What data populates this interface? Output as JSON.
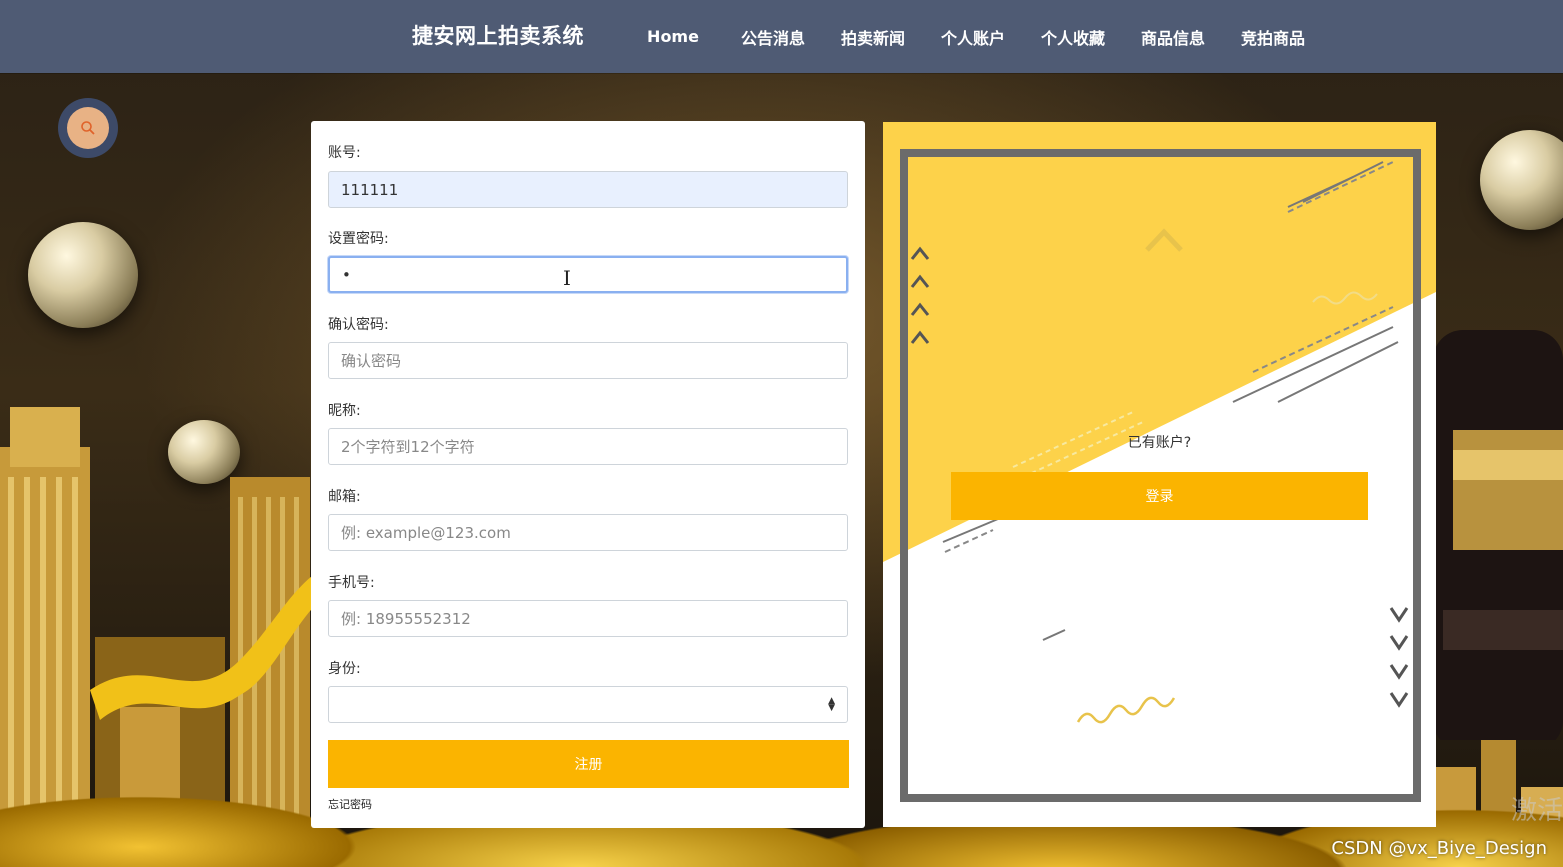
{
  "header": {
    "brand": "捷安网上拍卖系统",
    "nav": [
      {
        "label": "Home"
      },
      {
        "label": "公告消息"
      },
      {
        "label": "拍卖新闻"
      },
      {
        "label": "个人账户"
      },
      {
        "label": "个人收藏"
      },
      {
        "label": "商品信息"
      },
      {
        "label": "竞拍商品"
      }
    ]
  },
  "search": {
    "icon": "search-icon"
  },
  "form": {
    "account": {
      "label": "账号:",
      "value": "111111"
    },
    "password": {
      "label": "设置密码:",
      "value": "•"
    },
    "confirm": {
      "label": "确认密码:",
      "placeholder": "确认密码"
    },
    "nickname": {
      "label": "昵称:",
      "placeholder": "2个字符到12个字符"
    },
    "email": {
      "label": "邮箱:",
      "placeholder": "例: example@123.com"
    },
    "phone": {
      "label": "手机号:",
      "placeholder": "例: 18955552312"
    },
    "role": {
      "label": "身份:",
      "value": ""
    },
    "submit_label": "注册",
    "forgot_label": "忘记密码"
  },
  "panel": {
    "question": "已有账户?",
    "login_label": "登录"
  },
  "colors": {
    "header": "#4f5b74",
    "accent": "#fbb400",
    "panel_yellow": "#fdd24a"
  },
  "overlay": {
    "watermark": "CSDN @vx_Biye_Design",
    "activate": "激活"
  }
}
